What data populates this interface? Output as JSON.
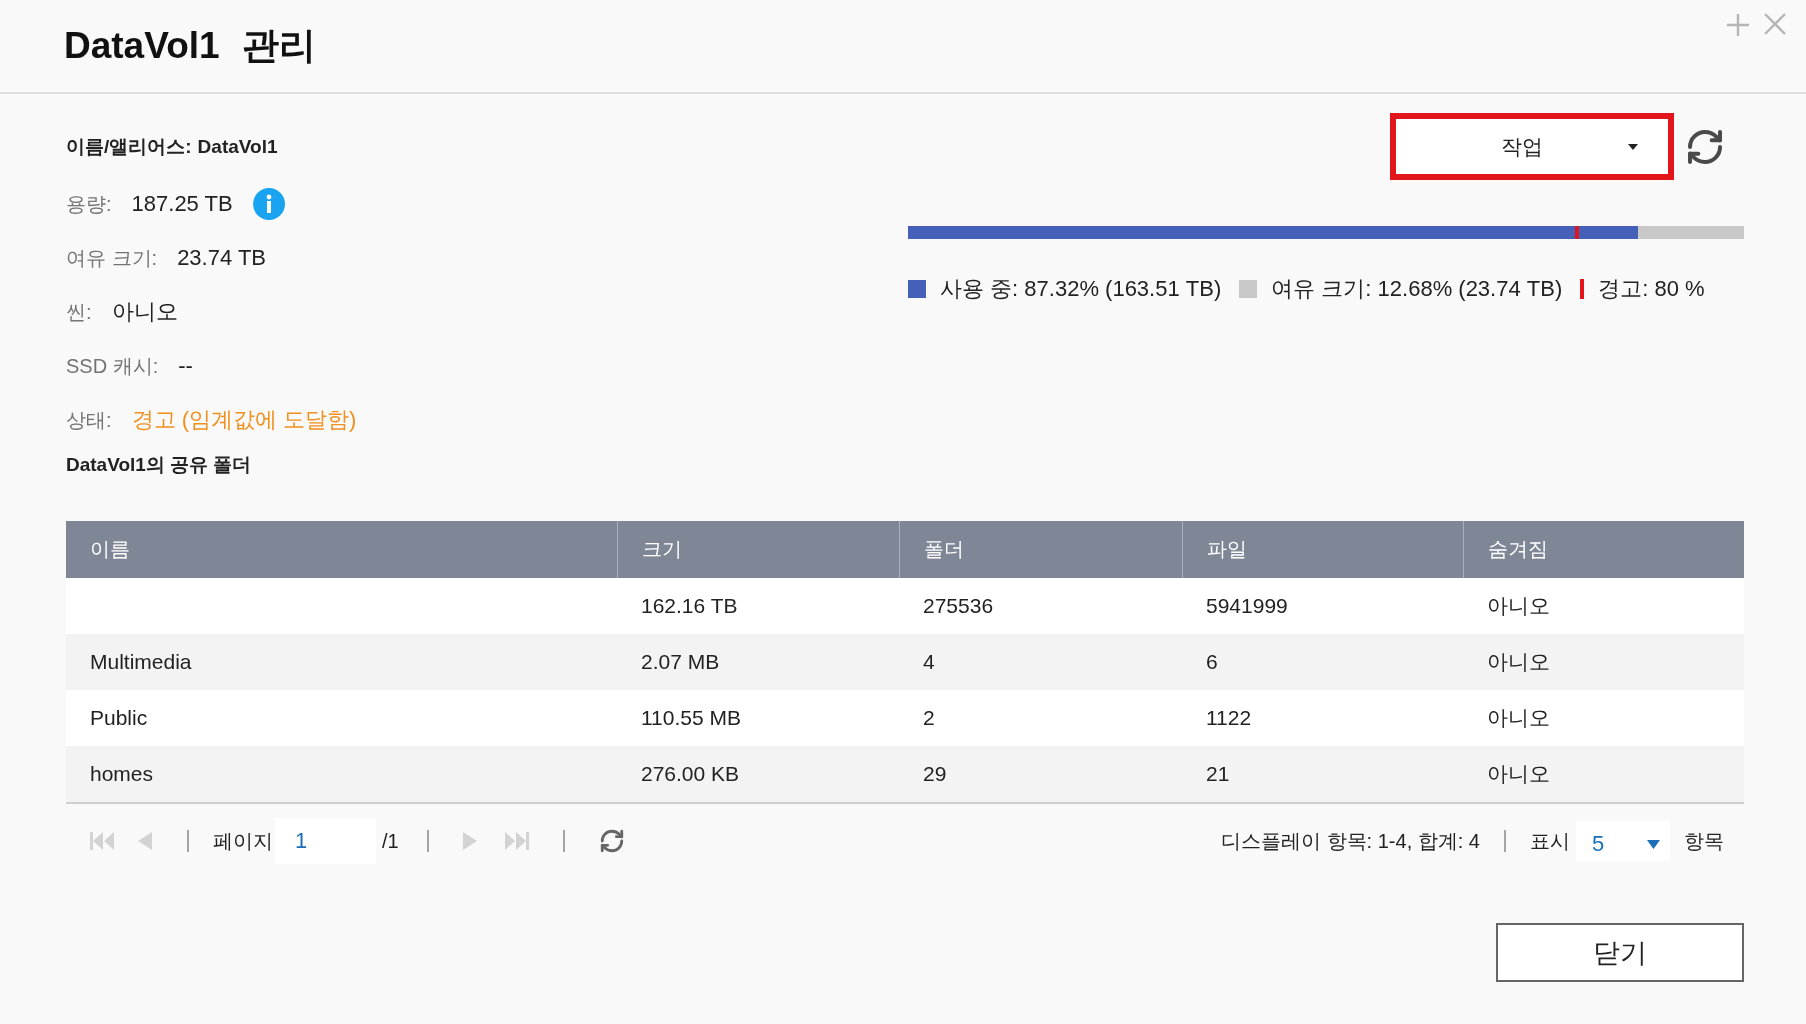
{
  "window": {
    "title": "DataVol1 관리"
  },
  "details": [
    {
      "kind": "heading",
      "label": "이름/앨리어스:",
      "value": "DataVol1",
      "info": false
    },
    {
      "kind": "plain",
      "label": "용량:",
      "value": "187.25 TB",
      "info": true
    },
    {
      "kind": "plain",
      "label": "여유 크기:",
      "value": "23.74 TB",
      "info": false
    },
    {
      "kind": "plain",
      "label": "씬:",
      "value": "아니오",
      "info": false
    },
    {
      "kind": "plain",
      "label": "SSD 캐시:",
      "value": "--",
      "info": false
    },
    {
      "kind": "warning",
      "label": "상태:",
      "value": "경고 (임계값에 도달함)",
      "info": false
    }
  ],
  "actions": {
    "label": "작업",
    "highlighted": true
  },
  "usage": {
    "level": 0.8732,
    "threshold": {
      "level": 0.8
    },
    "legend": [
      {
        "kind": "used",
        "text": "사용 중: 87.32% (163.51 TB)"
      },
      {
        "kind": "free",
        "text": "여유 크기: 12.68% (23.74 TB)"
      },
      {
        "kind": "warning",
        "text": "경고: 80 %"
      }
    ]
  },
  "section_title": "DataVol1의 공유 폴더",
  "table": {
    "columns": [
      "이름",
      "크기",
      "폴더",
      "파일",
      "숨겨짐"
    ],
    "rows": [
      {
        "size": "162.16 TB",
        "folders": "275536",
        "files": "5941999",
        "hidden": "아니오"
      },
      {
        "name": "Multimedia",
        "size": "2.07 MB",
        "folders": "4",
        "files": "6",
        "hidden": "아니오"
      },
      {
        "name": "Public",
        "size": "110.55 MB",
        "folders": "2",
        "files": "1122",
        "hidden": "아니오"
      },
      {
        "name": "homes",
        "size": "276.00 KB",
        "folders": "29",
        "files": "21",
        "hidden": "아니오"
      }
    ]
  },
  "pagination": {
    "nav_before": [
      {
        "kind": "first",
        "disabled": true
      },
      {
        "kind": "prev",
        "disabled": true
      }
    ],
    "page_label": "페이지",
    "page": "1",
    "page_total": "/1",
    "nav_after": [
      {
        "kind": "next",
        "disabled": true
      },
      {
        "kind": "last",
        "disabled": true
      }
    ],
    "refresh": {
      "disabled": false
    },
    "summary": "디스플레이 항목: 1-4, 합계: 4",
    "per_page_label": "표시",
    "per_page": "5",
    "per_page_unit": "항목"
  },
  "buttons": [
    {
      "label": "닫기"
    }
  ]
}
